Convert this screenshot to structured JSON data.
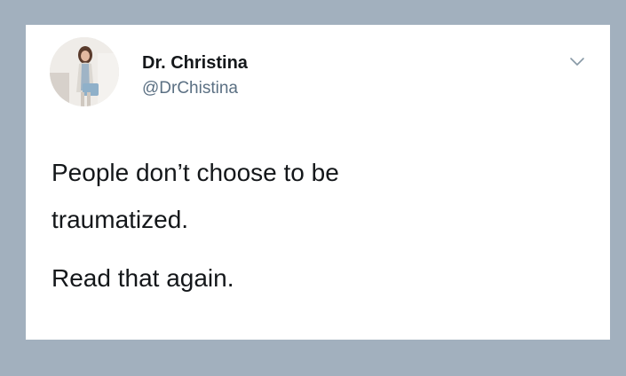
{
  "tweet": {
    "author": {
      "display_name": "Dr. Christina",
      "handle": "@DrChistina",
      "avatar_icon": "profile-photo"
    },
    "menu_icon": "chevron-down-icon",
    "text_lines": [
      "People don’t choose to be",
      "traumatized."
    ],
    "second_paragraph": "Read that again."
  },
  "colors": {
    "page_background": "#a2b0be",
    "card_background": "#ffffff",
    "text_primary": "#14171a",
    "text_secondary": "#5b7083"
  }
}
